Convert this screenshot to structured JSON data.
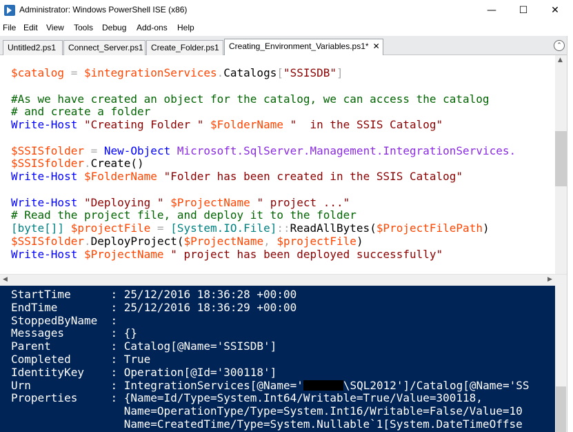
{
  "window": {
    "title": "Administrator: Windows PowerShell ISE (x86)",
    "minimize_glyph": "—",
    "maximize_glyph": "☐",
    "close_glyph": "✕"
  },
  "menu": [
    "File",
    "Edit",
    "View",
    "Tools",
    "Debug",
    "Add-ons",
    "Help"
  ],
  "tabs": [
    {
      "label": "Untitled2.ps1",
      "active": false
    },
    {
      "label": "Connect_Server.ps1",
      "active": false
    },
    {
      "label": "Create_Folder.ps1",
      "active": false
    },
    {
      "label": "Creating_Environment_Variables.ps1*",
      "active": true,
      "close": "✕"
    }
  ],
  "collapse_glyph": "⌃",
  "editor": {
    "lines": [
      [
        {
          "t": "$catalog",
          "c": "var"
        },
        {
          "t": " = ",
          "c": "op"
        },
        {
          "t": "$integrationServices",
          "c": "var"
        },
        {
          "t": ".",
          "c": "op"
        },
        {
          "t": "Catalogs",
          "c": "mem"
        },
        {
          "t": "[",
          "c": "op"
        },
        {
          "t": "\"SSISDB\"",
          "c": "str"
        },
        {
          "t": "]",
          "c": "op"
        }
      ],
      [],
      [
        {
          "t": "#As we have created an object for the catalog, we can access the catalog",
          "c": "cmt"
        }
      ],
      [
        {
          "t": "# and create a folder",
          "c": "cmt"
        }
      ],
      [
        {
          "t": "Write-Host",
          "c": "cmd"
        },
        {
          "t": " ",
          "c": "mem"
        },
        {
          "t": "\"Creating Folder \"",
          "c": "str"
        },
        {
          "t": " ",
          "c": "mem"
        },
        {
          "t": "$FolderName",
          "c": "var"
        },
        {
          "t": " ",
          "c": "mem"
        },
        {
          "t": "\"  in the SSIS Catalog\"",
          "c": "str"
        }
      ],
      [],
      [
        {
          "t": "$SSISfolder",
          "c": "var"
        },
        {
          "t": " = ",
          "c": "op"
        },
        {
          "t": "New-Object",
          "c": "cmd"
        },
        {
          "t": " ",
          "c": "mem"
        },
        {
          "t": "Microsoft.SqlServer.Management.IntegrationServices.",
          "c": "tname"
        }
      ],
      [
        {
          "t": "$SSISfolder",
          "c": "var"
        },
        {
          "t": ".",
          "c": "op"
        },
        {
          "t": "Create",
          "c": "mem"
        },
        {
          "t": "()",
          "c": "mem"
        }
      ],
      [
        {
          "t": "Write-Host",
          "c": "cmd"
        },
        {
          "t": " ",
          "c": "mem"
        },
        {
          "t": "$FolderName",
          "c": "var"
        },
        {
          "t": " ",
          "c": "mem"
        },
        {
          "t": "\"Folder has been created in the SSIS Catalog\"",
          "c": "str"
        }
      ],
      [],
      [
        {
          "t": "Write-Host",
          "c": "cmd"
        },
        {
          "t": " ",
          "c": "mem"
        },
        {
          "t": "\"Deploying \"",
          "c": "str"
        },
        {
          "t": " ",
          "c": "mem"
        },
        {
          "t": "$ProjectName",
          "c": "var"
        },
        {
          "t": " ",
          "c": "mem"
        },
        {
          "t": "\" project ...\"",
          "c": "str"
        }
      ],
      [
        {
          "t": "# Read the project file, and deploy it to the folder",
          "c": "cmt"
        }
      ],
      [
        {
          "t": "[byte[]]",
          "c": "typ"
        },
        {
          "t": " ",
          "c": "mem"
        },
        {
          "t": "$projectFile",
          "c": "var"
        },
        {
          "t": " = ",
          "c": "op"
        },
        {
          "t": "[System.IO.File]",
          "c": "typ"
        },
        {
          "t": "::",
          "c": "op"
        },
        {
          "t": "ReadAllBytes",
          "c": "mem"
        },
        {
          "t": "(",
          "c": "mem"
        },
        {
          "t": "$ProjectFilePath",
          "c": "var"
        },
        {
          "t": ")",
          "c": "mem"
        }
      ],
      [
        {
          "t": "$SSISfolder",
          "c": "var"
        },
        {
          "t": ".",
          "c": "op"
        },
        {
          "t": "DeployProject",
          "c": "mem"
        },
        {
          "t": "(",
          "c": "mem"
        },
        {
          "t": "$ProjectName",
          "c": "var"
        },
        {
          "t": ", ",
          "c": "op"
        },
        {
          "t": "$projectFile",
          "c": "var"
        },
        {
          "t": ")",
          "c": "mem"
        }
      ],
      [
        {
          "t": "Write-Host",
          "c": "cmd"
        },
        {
          "t": " ",
          "c": "mem"
        },
        {
          "t": "$ProjectName",
          "c": "var"
        },
        {
          "t": " ",
          "c": "mem"
        },
        {
          "t": "\" project has been deployed successfully\"",
          "c": "str"
        }
      ]
    ]
  },
  "console": {
    "lines": [
      "StartTime      : 25/12/2016 18:36:28 +00:00",
      "EndTime        : 25/12/2016 18:36:29 +00:00",
      "StoppedByName  :",
      "Messages       : {}",
      "Parent         : Catalog[@Name='SSISDB']",
      "Completed      : True",
      "IdentityKey    : Operation[@Id='300118']",
      {
        "before": "Urn            : IntegrationServices[@Name='",
        "after": "\\SQL2012']/Catalog[@Name='SS"
      },
      "Properties     : {Name=Id/Type=System.Int64/Writable=True/Value=300118,",
      "                 Name=OperationType/Type=System.Int16/Writable=False/Value=10",
      "                 Name=CreatedTime/Type=System.Nullable`1[System.DateTimeOffse"
    ]
  }
}
